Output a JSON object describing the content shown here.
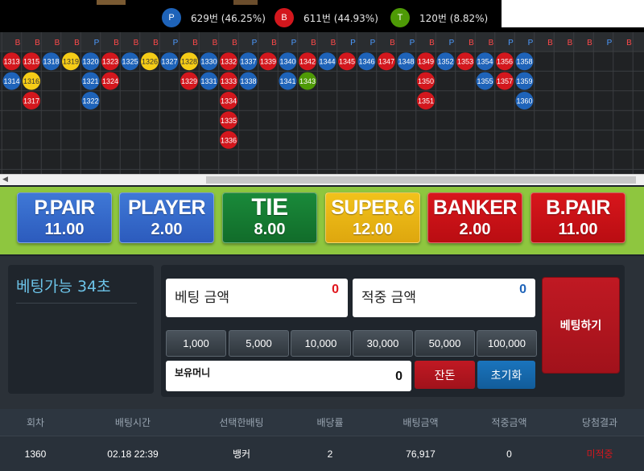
{
  "stats": {
    "player": {
      "letter": "P",
      "text": "629번 (46.25%)",
      "color": "#1e63b9"
    },
    "banker": {
      "letter": "B",
      "text": "611번 (44.93%)",
      "color": "#d3171d"
    },
    "tie": {
      "letter": "T",
      "text": "120번 (8.82%)",
      "color": "#4e9a06"
    }
  },
  "road": {
    "header_letters": [
      "B",
      "B",
      "B",
      "B",
      "P",
      "B",
      "B",
      "B",
      "P",
      "B",
      "B",
      "B",
      "P",
      "B",
      "P",
      "B",
      "B",
      "P",
      "P",
      "B",
      "P",
      "B",
      "P",
      "B",
      "B",
      "P",
      "P",
      "B",
      "B",
      "B",
      "P",
      "B",
      "P"
    ],
    "columns": [
      [
        {
          "n": "1313",
          "c": "r"
        },
        {
          "n": "1314",
          "c": "b"
        }
      ],
      [
        {
          "n": "1315",
          "c": "r"
        },
        {
          "n": "1316",
          "c": "y"
        },
        {
          "n": "1317",
          "c": "r"
        }
      ],
      [
        {
          "n": "1318",
          "c": "b"
        }
      ],
      [
        {
          "n": "1319",
          "c": "y"
        }
      ],
      [
        {
          "n": "1320",
          "c": "b"
        },
        {
          "n": "1321",
          "c": "b"
        },
        {
          "n": "1322",
          "c": "b"
        }
      ],
      [
        {
          "n": "1323",
          "c": "r"
        },
        {
          "n": "1324",
          "c": "r"
        }
      ],
      [
        {
          "n": "1325",
          "c": "b"
        }
      ],
      [
        {
          "n": "1326",
          "c": "y"
        }
      ],
      [
        {
          "n": "1327",
          "c": "b"
        }
      ],
      [
        {
          "n": "1328",
          "c": "y"
        },
        {
          "n": "1329",
          "c": "r"
        }
      ],
      [
        {
          "n": "1330",
          "c": "b"
        },
        {
          "n": "1331",
          "c": "b"
        }
      ],
      [
        {
          "n": "1332",
          "c": "r"
        },
        {
          "n": "1333",
          "c": "r"
        },
        {
          "n": "1334",
          "c": "r"
        },
        {
          "n": "1335",
          "c": "r"
        },
        {
          "n": "1336",
          "c": "r"
        }
      ],
      [
        {
          "n": "1337",
          "c": "b"
        },
        {
          "n": "1338",
          "c": "b"
        }
      ],
      [
        {
          "n": "1339",
          "c": "r"
        }
      ],
      [
        {
          "n": "1340",
          "c": "b"
        },
        {
          "n": "1341",
          "c": "b"
        }
      ],
      [
        {
          "n": "1342",
          "c": "r"
        },
        {
          "n": "1343",
          "c": "g"
        }
      ],
      [
        {
          "n": "1344",
          "c": "b"
        }
      ],
      [
        {
          "n": "1345",
          "c": "r"
        }
      ],
      [
        {
          "n": "1346",
          "c": "b"
        }
      ],
      [
        {
          "n": "1347",
          "c": "r"
        }
      ],
      [
        {
          "n": "1348",
          "c": "b"
        }
      ],
      [
        {
          "n": "1349",
          "c": "r"
        },
        {
          "n": "1350",
          "c": "r"
        },
        {
          "n": "1351",
          "c": "r"
        }
      ],
      [
        {
          "n": "1352",
          "c": "b"
        }
      ],
      [
        {
          "n": "1353",
          "c": "r"
        }
      ],
      [
        {
          "n": "1354",
          "c": "b"
        },
        {
          "n": "1355",
          "c": "b"
        }
      ],
      [
        {
          "n": "1356",
          "c": "r"
        },
        {
          "n": "1357",
          "c": "r"
        }
      ],
      [
        {
          "n": "1358",
          "c": "b"
        },
        {
          "n": "1359",
          "c": "b"
        },
        {
          "n": "1360",
          "c": "b"
        }
      ]
    ]
  },
  "bet_options": [
    {
      "name": "P.PAIR",
      "odds": "11.00"
    },
    {
      "name": "PLAYER",
      "odds": "2.00"
    },
    {
      "name": "TIE",
      "odds": "8.00"
    },
    {
      "name": "SUPER.6",
      "odds": "12.00"
    },
    {
      "name": "BANKER",
      "odds": "2.00"
    },
    {
      "name": "B.PAIR",
      "odds": "11.00"
    }
  ],
  "timer": {
    "label": "베팅가능 34초"
  },
  "bet_amount": {
    "label": "베팅 금액",
    "value": "0"
  },
  "win_amount": {
    "label": "적중 금액",
    "value": "0"
  },
  "chips": [
    "1,000",
    "5,000",
    "10,000",
    "30,000",
    "50,000",
    "100,000"
  ],
  "balance": {
    "label": "보유머니",
    "value": "0"
  },
  "buttons": {
    "change": "잔돈",
    "reset": "초기화",
    "bet": "베팅하기"
  },
  "table": {
    "headers": [
      "회차",
      "배팅시간",
      "선택한배팅",
      "배당률",
      "배팅금액",
      "적중금액",
      "당첨결과"
    ],
    "rows": [
      [
        "1360",
        "02.18 22:39",
        "뱅커",
        "2",
        "76,917",
        "0",
        "미적중"
      ]
    ]
  },
  "colors": {
    "player": "#1e63b9",
    "banker": "#d3171d",
    "tie": "#4e9a06",
    "super6": "#f2c21b",
    "accent_panel": "#8ec63f"
  }
}
